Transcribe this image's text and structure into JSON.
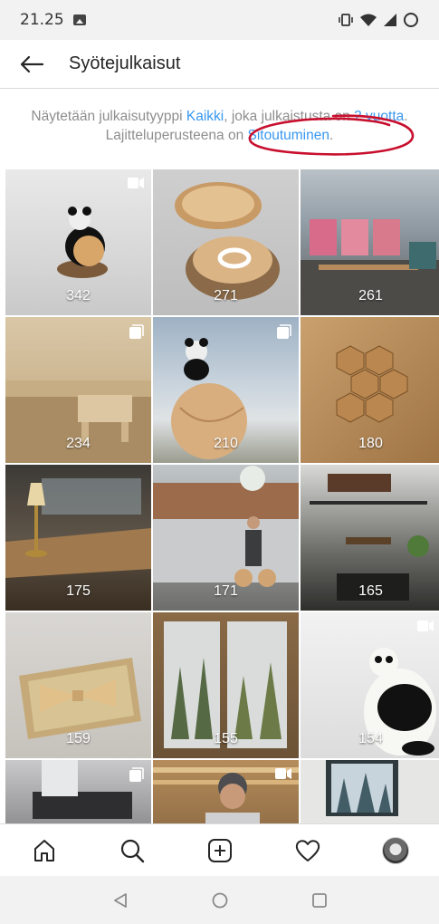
{
  "status_bar": {
    "time": "21.25"
  },
  "header": {
    "title": "Syötejulkaisut"
  },
  "info": {
    "part1": "Näytetään julkaisutyyppi ",
    "type_link": "Kaikki",
    "part2": ", joka julkaistusta on ",
    "period_link": "2 vuotta",
    "part3": ". Lajitteluperusteena on ",
    "sort_link": "Sitoutuminen",
    "part4": "."
  },
  "posts": [
    {
      "count": "342",
      "badge": "video"
    },
    {
      "count": "271",
      "badge": ""
    },
    {
      "count": "261",
      "badge": ""
    },
    {
      "count": "234",
      "badge": "carousel"
    },
    {
      "count": "210",
      "badge": "carousel"
    },
    {
      "count": "180",
      "badge": ""
    },
    {
      "count": "175",
      "badge": ""
    },
    {
      "count": "171",
      "badge": ""
    },
    {
      "count": "165",
      "badge": ""
    },
    {
      "count": "159",
      "badge": ""
    },
    {
      "count": "155",
      "badge": ""
    },
    {
      "count": "154",
      "badge": "video"
    },
    {
      "count": "",
      "badge": "carousel"
    },
    {
      "count": "",
      "badge": "video"
    },
    {
      "count": "",
      "badge": ""
    }
  ],
  "nav_icons": [
    "home-icon",
    "search-icon",
    "new-post-icon",
    "activity-heart-icon",
    "profile-avatar"
  ],
  "colors": {
    "link": "#3897f0",
    "annotation": "#c8102e"
  }
}
